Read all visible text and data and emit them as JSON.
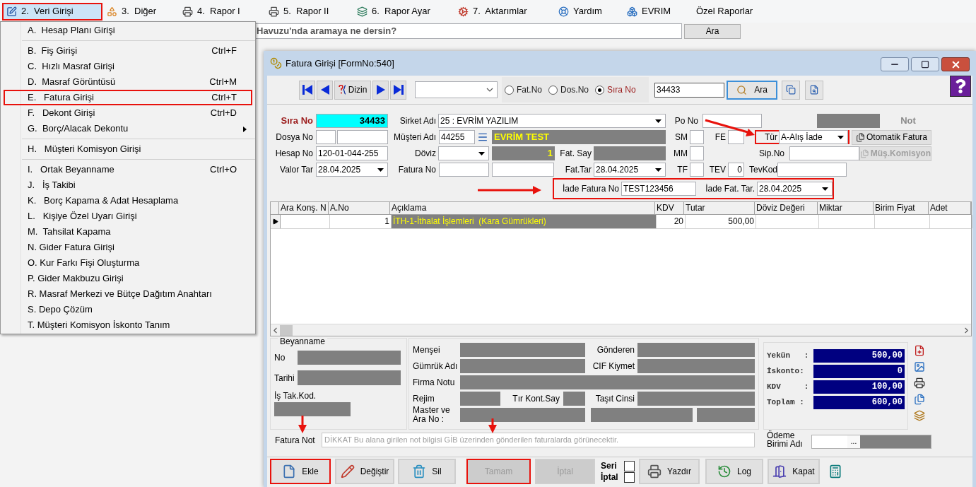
{
  "menu_bar": [
    {
      "label": "2.  Veri Girişi",
      "selected": true,
      "highlighted": true
    },
    {
      "label": "3.  Diğer",
      "selected": false,
      "highlighted": false
    },
    {
      "label": "4.  Rapor I",
      "selected": false,
      "highlighted": false
    },
    {
      "label": "5.  Rapor II",
      "selected": false,
      "highlighted": false
    },
    {
      "label": "6.  Rapor Ayar",
      "selected": false,
      "highlighted": false
    },
    {
      "label": "7.  Aktarımlar",
      "selected": false,
      "highlighted": false
    },
    {
      "label": "Yardım",
      "selected": false,
      "highlighted": false
    },
    {
      "label": "EVRIM",
      "selected": false,
      "highlighted": false
    },
    {
      "label": "Özel Raporlar",
      "selected": false,
      "highlighted": false
    }
  ],
  "search_strip": {
    "placeholder": "Havuzu'nda aramaya ne dersin?",
    "button": "Ara"
  },
  "menu": {
    "items": [
      {
        "kind": "item",
        "label": "A.  Hesap Planı Girişi",
        "submenu": false,
        "highlighted": false
      },
      {
        "kind": "separator"
      },
      {
        "kind": "item",
        "label": "B.  Fiş Girişi",
        "shortcut": "Ctrl+F",
        "submenu": false,
        "highlighted": false
      },
      {
        "kind": "item",
        "label": "C.  Hızlı Masraf Girişi",
        "submenu": false,
        "highlighted": false
      },
      {
        "kind": "item",
        "label": "D.  Masraf Görüntüsü",
        "shortcut": "Ctrl+M",
        "submenu": false,
        "highlighted": false
      },
      {
        "kind": "item",
        "label": "E.   Fatura Girişi",
        "shortcut": "Ctrl+T",
        "submenu": false,
        "highlighted": true
      },
      {
        "kind": "item",
        "label": "F.   Dekont Girişi",
        "shortcut": "Ctrl+D",
        "submenu": false,
        "highlighted": false
      },
      {
        "kind": "item",
        "label": "G.  Borç/Alacak Dekontu",
        "submenu": true,
        "highlighted": false
      },
      {
        "kind": "separator"
      },
      {
        "kind": "item",
        "label": "H.   Müşteri Komisyon Girişi",
        "submenu": false,
        "highlighted": false
      },
      {
        "kind": "separator"
      },
      {
        "kind": "item",
        "label": "I.   Ortak Beyanname",
        "shortcut": "Ctrl+O",
        "submenu": false,
        "highlighted": false
      },
      {
        "kind": "item",
        "label": "J.   İş Takibi",
        "submenu": false,
        "highlighted": false
      },
      {
        "kind": "item",
        "label": "K.   Borç Kapama & Adat Hesaplama",
        "submenu": false,
        "highlighted": false
      },
      {
        "kind": "item",
        "label": "L.   Kişiye Özel Uyarı Girişi",
        "submenu": false,
        "highlighted": false
      },
      {
        "kind": "item",
        "label": "M.  Tahsilat Kapama",
        "submenu": false,
        "highlighted": false
      },
      {
        "kind": "item",
        "label": "N. Gider Fatura Girişi",
        "submenu": false,
        "highlighted": false
      },
      {
        "kind": "item",
        "label": "O. Kur Farkı Fişi Oluşturma",
        "submenu": false,
        "highlighted": false
      },
      {
        "kind": "item",
        "label": "P. Gider Makbuzu Girişi",
        "submenu": false,
        "highlighted": false
      },
      {
        "kind": "item",
        "label": "R. Masraf Merkezi ve Bütçe Dağıtım Anahtarı",
        "submenu": false,
        "highlighted": false
      },
      {
        "kind": "item",
        "label": "S. Depo Çözüm",
        "submenu": false,
        "highlighted": false
      },
      {
        "kind": "item",
        "label": "T. Müşteri Komisyon İskonto Tanım",
        "submenu": false,
        "highlighted": false
      }
    ]
  },
  "window": {
    "title": "Fatura Girişi [FormNo:540]"
  },
  "toolbar": {
    "nav": [
      {
        "kind": "first"
      },
      {
        "kind": "prev"
      },
      {
        "kind": "index",
        "label": "Dizin"
      },
      {
        "kind": "next"
      },
      {
        "kind": "last"
      }
    ],
    "radios": [
      {
        "label": "Fat.No",
        "selected": false
      },
      {
        "label": "Dos.No",
        "selected": false
      },
      {
        "label": "Sıra No",
        "selected": true
      }
    ],
    "search_value": "34433",
    "search_button": {
      "label": "Ara",
      "focused": true
    }
  },
  "header_rows": [
    [
      {
        "kind": "title-label",
        "text": "Sıra No"
      },
      {
        "kind": "key-field",
        "value": "34433"
      },
      {
        "kind": "label",
        "text": "Sirket Adı"
      },
      {
        "kind": "combo",
        "value": "25 : EVRİM YAZILIM"
      },
      {
        "kind": "label",
        "text": "Po No"
      },
      {
        "kind": "field"
      },
      {
        "kind": "readonly"
      },
      {
        "kind": "note-label",
        "text": "Not"
      }
    ],
    [
      {
        "kind": "label",
        "text": "Dosya No"
      },
      {
        "kind": "field"
      },
      {
        "kind": "field"
      },
      {
        "kind": "label",
        "text": "Müşteri Adı"
      },
      {
        "kind": "field",
        "value": "44255"
      },
      {
        "kind": "lookup-button"
      },
      {
        "kind": "readonly",
        "value": "EVRİM TEST"
      },
      {
        "kind": "label",
        "text": "SM"
      },
      {
        "kind": "field"
      },
      {
        "kind": "label",
        "text": "FE"
      },
      {
        "kind": "field"
      },
      {
        "kind": "group",
        "highlighted": true,
        "items": [
          {
            "kind": "label",
            "text": "Tür"
          },
          {
            "kind": "combo",
            "value": "A-Alış İade"
          }
        ]
      },
      {
        "kind": "button",
        "label": "Otomatik Fatura",
        "disabled": false
      }
    ],
    [
      {
        "kind": "label",
        "text": "Hesap No"
      },
      {
        "kind": "field",
        "value": "120-01-044-255"
      },
      {
        "kind": "label",
        "text": "Döviz"
      },
      {
        "kind": "combo"
      },
      {
        "kind": "readonly-number",
        "value": "1"
      },
      {
        "kind": "label",
        "text": "Fat. Say"
      },
      {
        "kind": "readonly"
      },
      {
        "kind": "label",
        "text": "MM"
      },
      {
        "kind": "field"
      },
      {
        "kind": "label",
        "text": "Sip.No"
      },
      {
        "kind": "field"
      },
      {
        "kind": "button",
        "label": "Müş.Komisyon",
        "disabled": true
      }
    ],
    [
      {
        "kind": "label",
        "text": "Valor Tar"
      },
      {
        "kind": "combo",
        "value": "28.04.2025"
      },
      {
        "kind": "label",
        "text": "Fatura No"
      },
      {
        "kind": "field"
      },
      {
        "kind": "field"
      },
      {
        "kind": "label",
        "text": "Fat.Tar"
      },
      {
        "kind": "combo",
        "value": "28.04.2025"
      },
      {
        "kind": "label",
        "text": "TF"
      },
      {
        "kind": "field"
      },
      {
        "kind": "label",
        "text": "TEV"
      },
      {
        "kind": "number-field",
        "value": "0"
      },
      {
        "kind": "label",
        "text": "TevKod"
      },
      {
        "kind": "field"
      }
    ],
    [
      {
        "kind": "group",
        "highlighted": true,
        "items": [
          {
            "kind": "label",
            "text": "İade Fatura No"
          },
          {
            "kind": "field",
            "value": "TEST123456"
          },
          {
            "kind": "label",
            "text": "İade Fat. Tar."
          },
          {
            "kind": "combo",
            "value": "28.04.2025"
          }
        ]
      }
    ]
  ],
  "grid": {
    "columns": [
      {
        "label": "Ara Konş. N",
        "kind": "text"
      },
      {
        "label": "A.No",
        "kind": "number"
      },
      {
        "label": "Açıklama",
        "kind": "readonly"
      },
      {
        "label": "KDV",
        "kind": "number"
      },
      {
        "label": "Tutar",
        "kind": "number"
      },
      {
        "label": "Döviz Değeri",
        "kind": "number"
      },
      {
        "label": "Miktar",
        "kind": "number"
      },
      {
        "label": "Birim Fiyat",
        "kind": "number"
      },
      {
        "label": "Adet",
        "kind": "number"
      }
    ],
    "rows": [
      {
        "current": true,
        "cells": [
          "",
          "1",
          "İTH-1-İthalat İşlemleri  (Kara Gümrükleri)",
          "20",
          "500,00",
          "",
          "",
          "",
          ""
        ]
      }
    ]
  },
  "customs": {
    "title": "Beyanname",
    "fields": [
      "No",
      "Tarihi",
      "İş Tak.Kod."
    ]
  },
  "details_rows": [
    [
      "Menşei",
      "Gönderen"
    ],
    [
      "Gümrük Adı",
      "CIF Kiymet"
    ],
    [
      "Firma Notu"
    ],
    [
      "Rejim",
      "Tır Kont.Say",
      "Taşıt Cinsi"
    ],
    [
      "Master ve Ara No :"
    ]
  ],
  "totals": [
    {
      "label": "Yekün   :",
      "value": "500,00"
    },
    {
      "label": "İskonto:",
      "value": "0"
    },
    {
      "label": "KDV     :",
      "value": "100,00"
    },
    {
      "label": "Toplam :",
      "value": "600,00"
    }
  ],
  "note": {
    "label": "Fatura Not",
    "placeholder": "DİKKAT Bu alana girilen not bilgisi GİB üzerinden gönderilen faturalarda görünecektir."
  },
  "payment": {
    "label": "Ödeme Birimi Adı",
    "button": "..."
  },
  "buttons": [
    {
      "kind": "button",
      "label": "Ekle",
      "disabled": false,
      "highlighted": true
    },
    {
      "kind": "button",
      "label": "Değiştir",
      "disabled": false,
      "highlighted": false
    },
    {
      "kind": "button",
      "label": "Sil",
      "disabled": false,
      "highlighted": false
    },
    {
      "kind": "button",
      "label": "Tamam",
      "disabled": true,
      "highlighted": true
    },
    {
      "kind": "button",
      "label": "İptal",
      "disabled": true,
      "highlighted": false
    },
    {
      "kind": "checks",
      "items": [
        {
          "label": "Seri",
          "checked": false
        },
        {
          "label": "İptal",
          "checked": false
        }
      ]
    },
    {
      "kind": "button",
      "label": "Yazdır",
      "disabled": false,
      "highlighted": false
    },
    {
      "kind": "button",
      "label": "Log",
      "disabled": false,
      "highlighted": false
    },
    {
      "kind": "button",
      "label": "Kapat",
      "disabled": false,
      "highlighted": false
    },
    {
      "kind": "calculator"
    }
  ]
}
